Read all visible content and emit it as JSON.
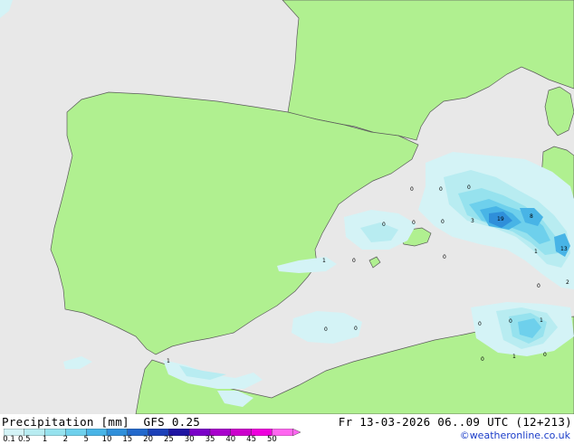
{
  "legend": {
    "title": "Precipitation [mm]",
    "model": "GFS 0.25",
    "ticks": [
      "0.1",
      "0.5",
      "1",
      "2",
      "5",
      "10",
      "15",
      "20",
      "25",
      "30",
      "35",
      "40",
      "45",
      "50"
    ],
    "colors": [
      "#d4f3f6",
      "#b8ecf1",
      "#96e2ee",
      "#6ed0ec",
      "#48b4e6",
      "#2f8fda",
      "#2369cc",
      "#1c40b8",
      "#1f14a2",
      "#7a00c8",
      "#a800cc",
      "#cc00cc",
      "#ee00dd",
      "#ff66f0"
    ]
  },
  "valid_time": "Fr 13-03-2026 06..09 UTC (12+213)",
  "credit": "©weatheronline.co.uk",
  "map_labels": [
    {
      "id": "v01",
      "text": "0"
    },
    {
      "id": "v02",
      "text": "0"
    },
    {
      "id": "v03",
      "text": "0"
    },
    {
      "id": "v04",
      "text": "0"
    },
    {
      "id": "v05",
      "text": "0"
    },
    {
      "id": "v06",
      "text": "0"
    },
    {
      "id": "v07",
      "text": "3"
    },
    {
      "id": "v08",
      "text": "19"
    },
    {
      "id": "v09",
      "text": "8"
    },
    {
      "id": "v10",
      "text": "1"
    },
    {
      "id": "v11",
      "text": "13"
    },
    {
      "id": "v12",
      "text": "0"
    },
    {
      "id": "v13",
      "text": "2"
    },
    {
      "id": "v14",
      "text": "1"
    },
    {
      "id": "v15",
      "text": "0"
    },
    {
      "id": "v16",
      "text": "0"
    },
    {
      "id": "v17",
      "text": "0"
    },
    {
      "id": "v18",
      "text": "0"
    },
    {
      "id": "v19",
      "text": "0"
    },
    {
      "id": "v20",
      "text": "0"
    },
    {
      "id": "v21",
      "text": "1"
    },
    {
      "id": "v22",
      "text": "0"
    },
    {
      "id": "v23",
      "text": "1"
    },
    {
      "id": "v24",
      "text": "0"
    },
    {
      "id": "v25",
      "text": "1"
    }
  ]
}
